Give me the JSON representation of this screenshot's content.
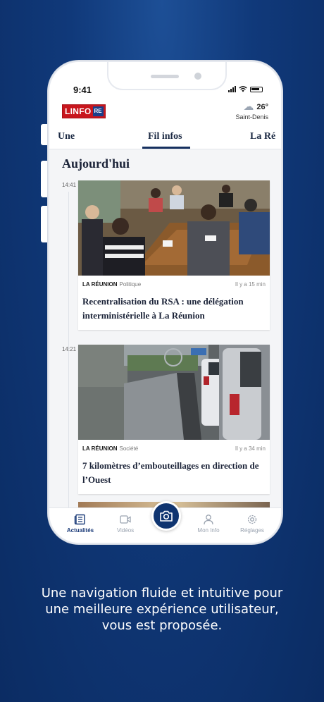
{
  "status": {
    "time": "9:41"
  },
  "header": {
    "logo_main": "LINFO",
    "logo_suffix": "RE",
    "weather_temp": "26°",
    "weather_city": "Saint-Denis",
    "weather_icon": "rain-cloud-icon"
  },
  "tabs": [
    {
      "label": "Une"
    },
    {
      "label": "Fil infos"
    },
    {
      "label": "La Ré"
    }
  ],
  "feed": {
    "day_title": "Aujourd'hui",
    "articles": [
      {
        "time": "14:41",
        "region": "LA RÉUNION",
        "category": "Politique",
        "ago": "Il y a 15 min",
        "title": "Recentralisation du RSA : une délégation interministérielle à La Réunion"
      },
      {
        "time": "14:21",
        "region": "LA RÉUNION",
        "category": "Société",
        "ago": "Il y a 34 min",
        "title": "7 kilomètres d’embouteillages en direction de l’Ouest"
      }
    ]
  },
  "nav": {
    "items": [
      {
        "label": "Actualités",
        "icon": "newspaper-icon"
      },
      {
        "label": "Vidéos",
        "icon": "video-icon"
      },
      {
        "label": "",
        "icon": "camera-icon"
      },
      {
        "label": "Mon Info",
        "icon": "user-icon"
      },
      {
        "label": "Réglages",
        "icon": "gear-icon"
      }
    ]
  },
  "promo": {
    "line1": "Une navigation fluide et intuitive pour",
    "line2": "une meilleure expérience utilisateur,",
    "line3": "vous est proposée."
  },
  "colors": {
    "background": "#10397a",
    "accent": "#0f3470",
    "logo_red": "#c8161d"
  }
}
